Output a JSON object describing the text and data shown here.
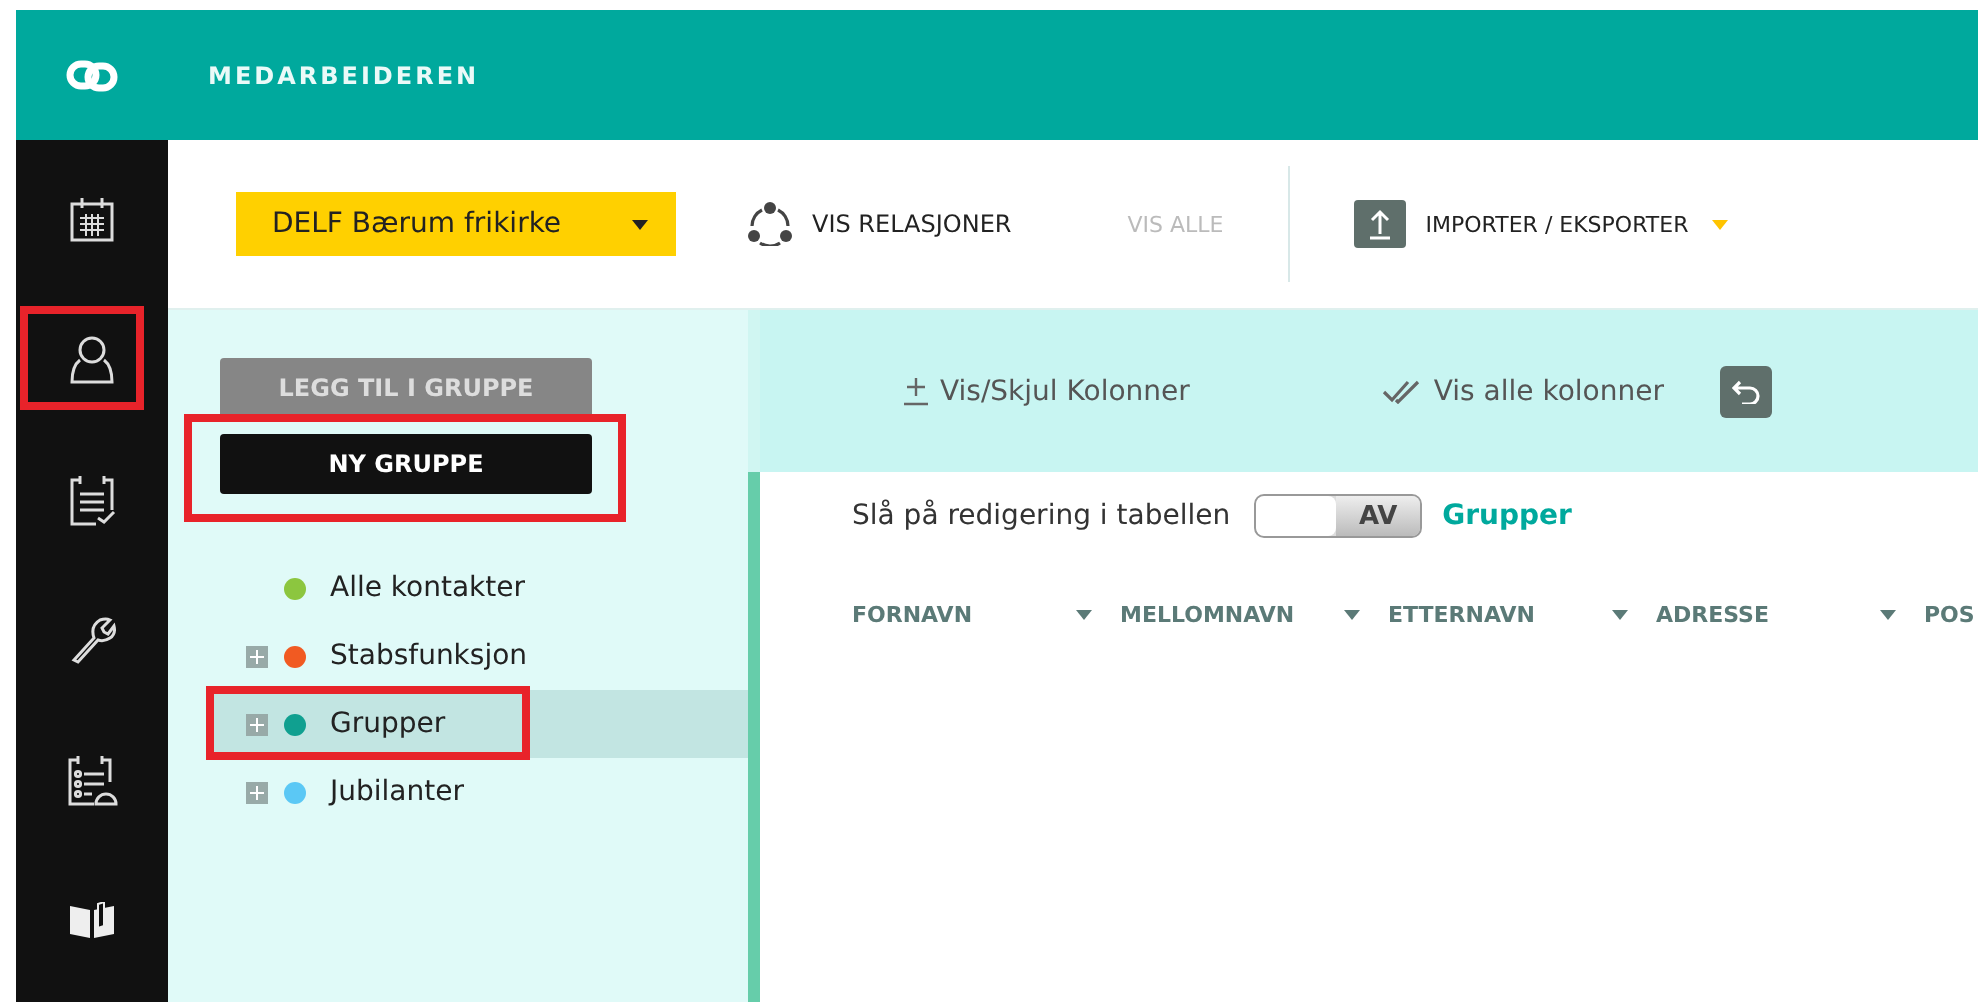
{
  "header": {
    "title": "MEDARBEIDEREN"
  },
  "sidebar": {
    "items": [
      {
        "kind": "calendar",
        "highlighted": false
      },
      {
        "kind": "person",
        "highlighted": true
      },
      {
        "kind": "clipboard-check",
        "highlighted": false
      },
      {
        "kind": "wrench",
        "highlighted": false
      },
      {
        "kind": "clipboard-list",
        "highlighted": false
      },
      {
        "kind": "book",
        "highlighted": false
      }
    ]
  },
  "toolbar": {
    "organization": "DELF Bærum frikirke",
    "show_relations": "VIS RELASJONER",
    "show_all": {
      "label": "VIS ALLE",
      "disabled": true
    },
    "import_export": "IMPORTER / EKSPORTER"
  },
  "group_panel": {
    "buttons": [
      {
        "label": "LEGG TIL I GRUPPE",
        "disabled": true,
        "highlighted": false
      },
      {
        "label": "NY GRUPPE",
        "disabled": false,
        "highlighted": true
      }
    ],
    "groups": [
      {
        "label": "Alle kontakter",
        "color": "#8cc63f",
        "expandable": false,
        "selected": false,
        "highlighted": false
      },
      {
        "label": "Stabsfunksjon",
        "color": "#f15a22",
        "expandable": true,
        "selected": false,
        "highlighted": false
      },
      {
        "label": "Grupper",
        "color": "#10a090",
        "expandable": true,
        "selected": true,
        "highlighted": true
      },
      {
        "label": "Jubilanter",
        "color": "#5bc8f5",
        "expandable": true,
        "selected": false,
        "highlighted": false
      }
    ]
  },
  "column_bar": {
    "toggle_columns": "Vis/Skjul Kolonner",
    "show_all_columns": "Vis alle kolonner"
  },
  "table": {
    "edit_label": "Slå på redigering i tabellen",
    "edit_toggle": {
      "on": false,
      "label": "AV"
    },
    "group_name": "Grupper",
    "columns": [
      "FORNAVN",
      "MELLOMNAVN",
      "ETTERNAVN",
      "ADRESSE",
      "POS"
    ]
  }
}
